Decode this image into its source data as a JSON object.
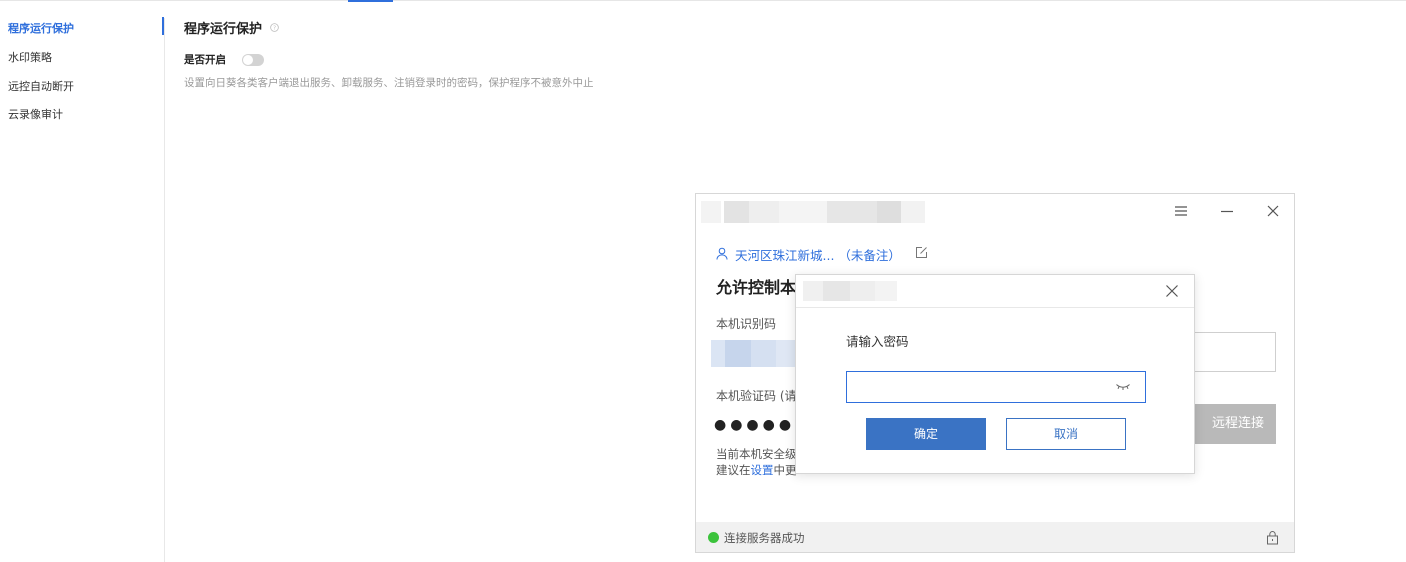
{
  "sidebar": {
    "items": [
      {
        "label": "程序运行保护"
      },
      {
        "label": "水印策略"
      },
      {
        "label": "远控自动断开"
      },
      {
        "label": "云录像审计"
      }
    ]
  },
  "settings": {
    "title": "程序运行保护",
    "help_icon": "question-circle-icon",
    "enable_label": "是否开启",
    "toggle_on": false,
    "description": "设置向日葵各类客户端退出服务、卸载服务、注销登录时的密码，保护程序不被意外中止"
  },
  "remote_window": {
    "device_name": "天河区珠江新城...",
    "remark": "（未备注）",
    "allow_title": "允许控制本",
    "id_label": "本机识别码",
    "verify_label": "本机验证码 (请",
    "password_mask": "●●●●●●",
    "security_line1": "当前本机安全级",
    "security_prefix": "建议在",
    "security_link": "设置",
    "security_suffix": "中更",
    "remote_button": "远程连接",
    "status_text": "连接服务器成功",
    "status_color": "#3cc33c"
  },
  "password_dialog": {
    "prompt": "请输入密码",
    "input_value": "",
    "confirm_label": "确定",
    "cancel_label": "取消",
    "accent": "#3a73c4"
  }
}
